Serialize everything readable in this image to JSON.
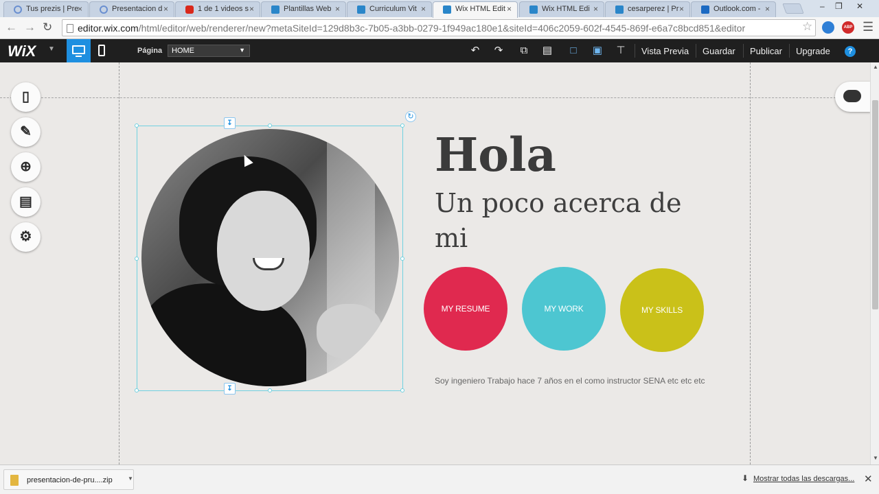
{
  "browser": {
    "tabs": [
      {
        "label": "Tus prezis | Pre",
        "icon": "globe-icon"
      },
      {
        "label": "Presentacion d",
        "icon": "globe-icon"
      },
      {
        "label": "1 de 1 videos s",
        "icon": "youtube-icon"
      },
      {
        "label": "Plantillas Web",
        "icon": "wix-icon"
      },
      {
        "label": "Curriculum Vit",
        "icon": "wix-icon"
      },
      {
        "label": "Wix HTML Edit",
        "icon": "wix-icon"
      },
      {
        "label": "Wix HTML Edi",
        "icon": "wix-icon"
      },
      {
        "label": "cesarperez | Pr",
        "icon": "wix-icon"
      },
      {
        "label": "Outlook.com -",
        "icon": "outlook-icon"
      }
    ],
    "tab_close_glyph": "×",
    "url_host": "editor.wix.com",
    "url_path": "/html/editor/web/renderer/new?metaSiteId=129d8b3c-7b05-a3bb-0279-1f949ac180e1&siteId=406c2059-602f-4545-869f-e6a7c8bcd851&editor",
    "extension_badge": "ABP"
  },
  "wix_toolbar": {
    "logo": "WiX",
    "page_label": "Página",
    "page_value": "HOME",
    "preview": "Vista Previa",
    "save": "Guardar",
    "publish": "Publicar",
    "upgrade": "Upgrade",
    "help": "?"
  },
  "site": {
    "greeting": "Hola",
    "subtitle": "Un poco acerca de mi",
    "buttons": [
      {
        "label": "MY RESUME",
        "color": "#e0294f"
      },
      {
        "label": "MY WORK",
        "color": "#4dc6d1"
      },
      {
        "label": "MY SKILLS",
        "color": "#cac119"
      }
    ],
    "bio": "Soy ingeniero Trabajo hace 7 años en el como instructor SENA etc etc etc"
  },
  "downloads": {
    "file_name": "presentacion-de-pru....zip",
    "show_all": "Mostrar todas las descargas..."
  },
  "colors": {
    "wix_blue": "#1e8fe0",
    "selection": "#6fd1e0"
  }
}
